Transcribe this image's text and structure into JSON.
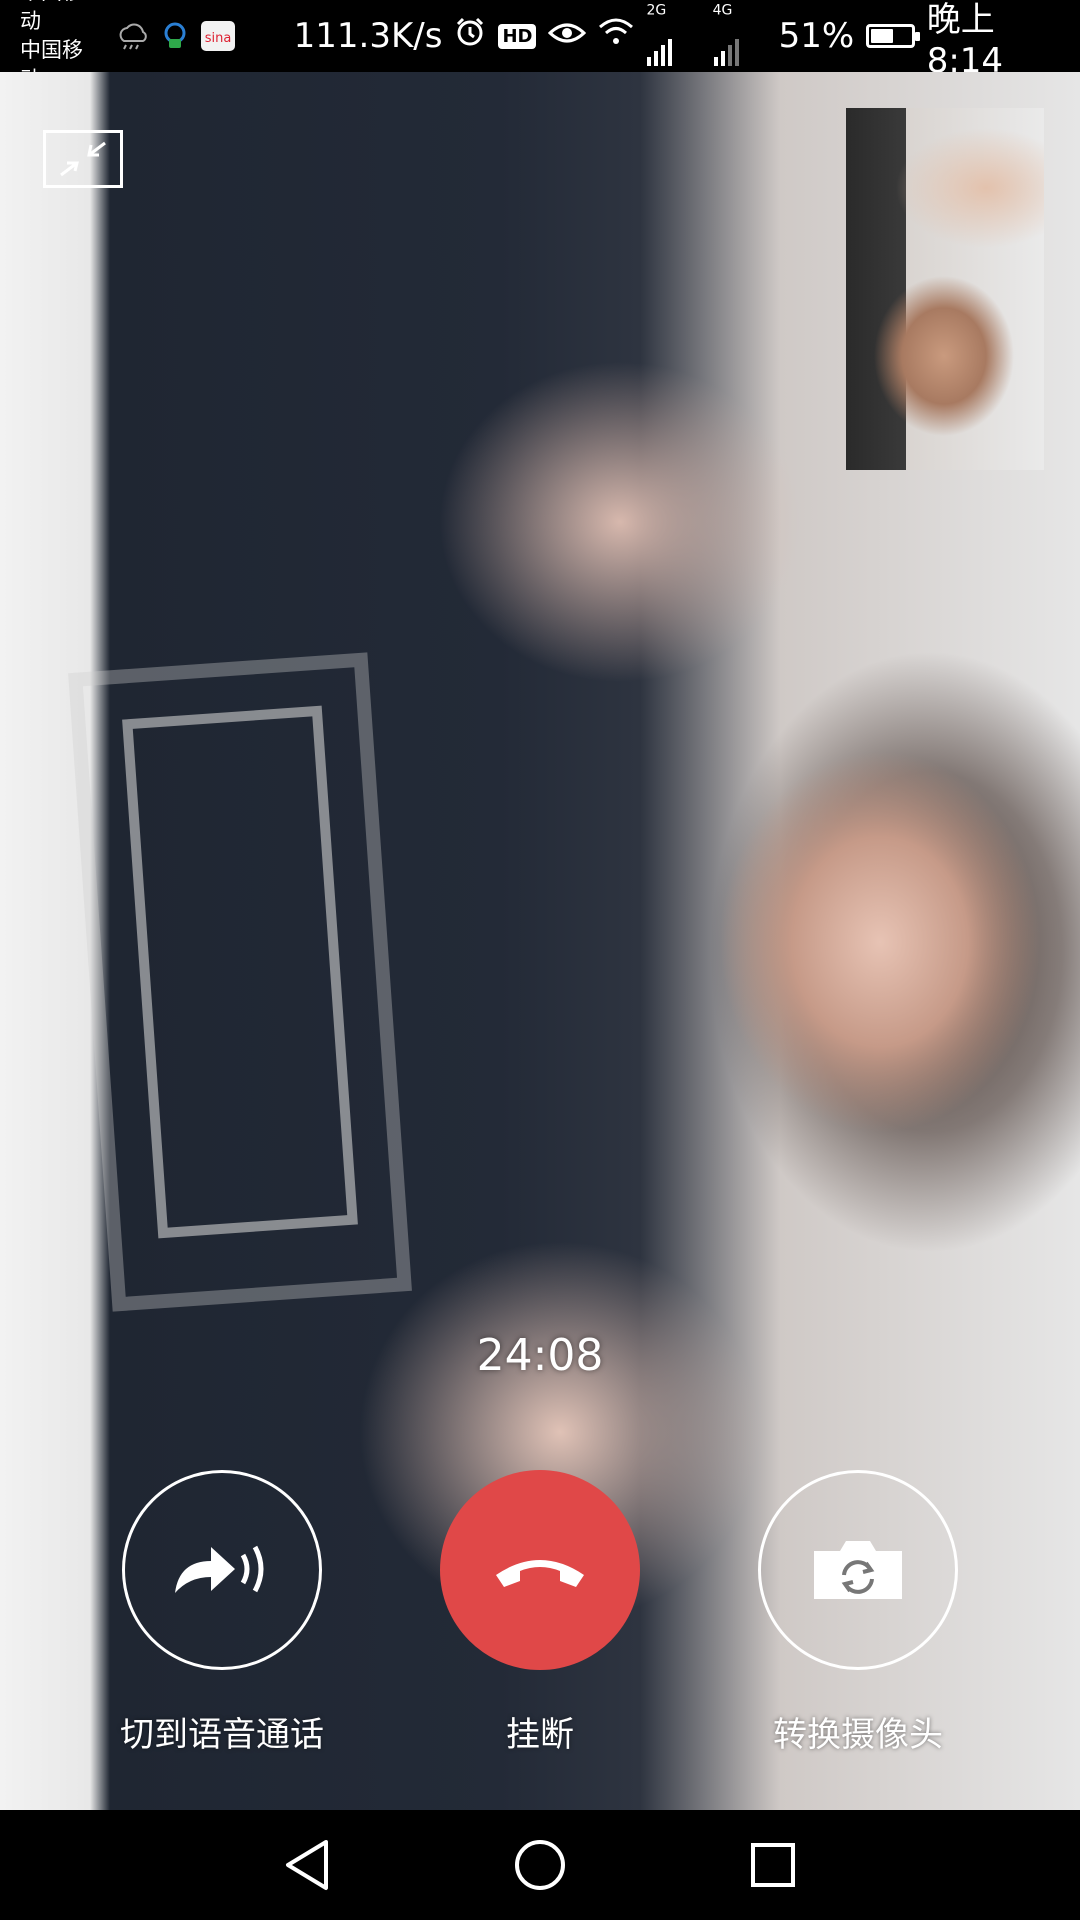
{
  "status_bar": {
    "carrier_1": "中国移动",
    "carrier_2": "中国移动",
    "net_speed": "111.3K/s",
    "hd_label": "HD",
    "signal_2g": "2G",
    "signal_4g": "4G",
    "battery_percent": "51%",
    "battery_level": 0.51,
    "time": "晚上8:14",
    "icons": [
      "weather-icon",
      "notification-icon",
      "sina-app-icon",
      "alarm-icon",
      "hd-icon",
      "eye-icon",
      "wifi-icon",
      "signal-icon",
      "battery-icon"
    ]
  },
  "call": {
    "timer": "24:08",
    "switch_voice_label": "切到语音通话",
    "hangup_label": "挂断",
    "switch_camera_label": "转换摄像头",
    "hangup_color": "#e04848"
  },
  "nav_bar": {
    "icons": [
      "back-icon",
      "home-icon",
      "recents-icon"
    ]
  }
}
